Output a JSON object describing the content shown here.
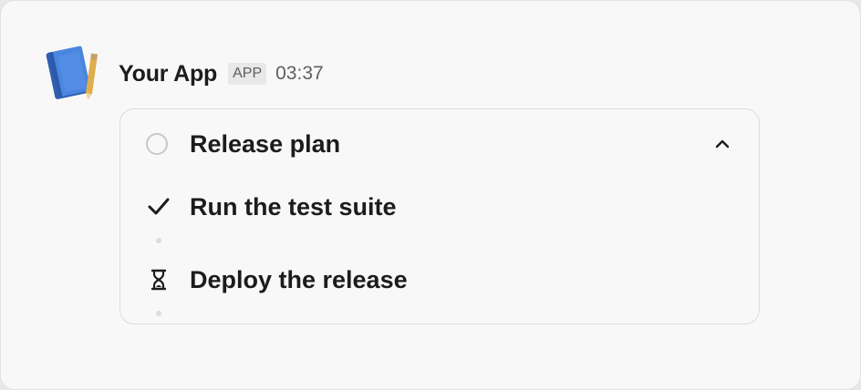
{
  "message": {
    "app_name": "Your App",
    "badge": "APP",
    "timestamp": "03:37",
    "avatar_icon": "notebook-pencil-icon"
  },
  "plan": {
    "title": "Release plan",
    "status_icon": "empty-circle-icon",
    "collapse_icon": "chevron-up-icon",
    "tasks": [
      {
        "label": "Run the test suite",
        "icon": "checkmark-icon",
        "status": "complete"
      },
      {
        "label": "Deploy the release",
        "icon": "hourglass-icon",
        "status": "in_progress"
      }
    ]
  },
  "colors": {
    "text": "#1d1c1d",
    "muted": "#616061",
    "border": "#dddcdc",
    "avatar_blue": "#3d78d8",
    "avatar_pencil": "#d9a441"
  }
}
